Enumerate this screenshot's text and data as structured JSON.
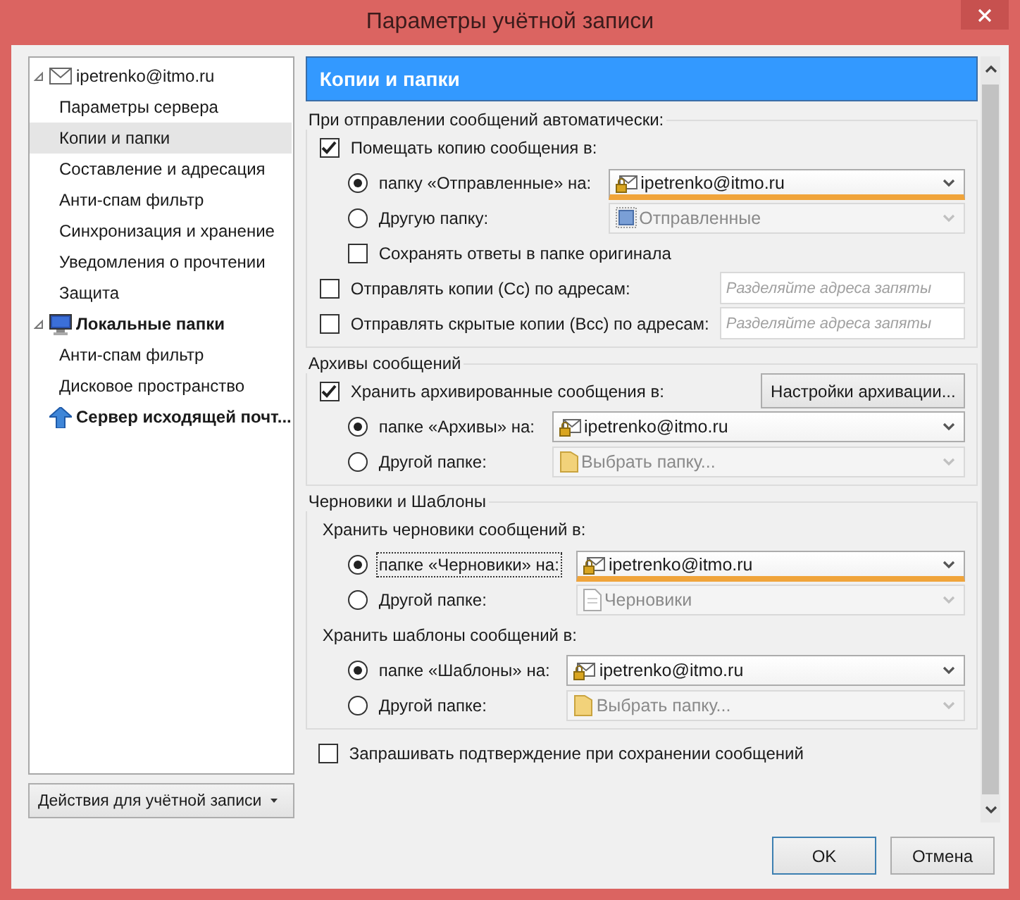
{
  "window": {
    "title": "Параметры учётной записи"
  },
  "sidebar": {
    "items": [
      {
        "label": "ipetrenko@itmo.ru",
        "kind": "mail",
        "bold": false,
        "expanded": true,
        "selected": false,
        "children": [
          {
            "label": "Параметры сервера",
            "selected": false
          },
          {
            "label": "Копии и папки",
            "selected": true
          },
          {
            "label": "Составление и адресация",
            "selected": false
          },
          {
            "label": "Анти-спам фильтр",
            "selected": false
          },
          {
            "label": "Синхронизация и хранение",
            "selected": false
          },
          {
            "label": "Уведомления о прочтении",
            "selected": false
          },
          {
            "label": "Защита",
            "selected": false
          }
        ]
      },
      {
        "label": "Локальные папки",
        "kind": "computer",
        "bold": true,
        "expanded": true,
        "selected": false,
        "children": [
          {
            "label": "Анти-спам фильтр",
            "selected": false
          },
          {
            "label": "Дисковое пространство",
            "selected": false
          }
        ]
      },
      {
        "label": "Сервер исходящей почт...",
        "kind": "upload",
        "bold": true,
        "selected": false
      }
    ]
  },
  "account_actions_button": "Действия для учётной записи",
  "panel": {
    "heading": "Копии и папки",
    "sections": [
      {
        "title": "При отправлении сообщений автоматически:",
        "rows": [
          {
            "kind": "checkbox",
            "label": "Помещать копию сообщения в:",
            "checked": true,
            "children": [
              {
                "kind": "radio",
                "label": "папку «Отправленные» на:",
                "selected": true,
                "focused": false,
                "combo": {
                  "value": "ipetrenko@itmo.ru",
                  "kind": "account",
                  "disabled": false,
                  "highlighted": true
                }
              },
              {
                "kind": "radio",
                "label": "Другую папку:",
                "selected": false,
                "focused": false,
                "combo": {
                  "value": "Отправленные",
                  "kind": "sent",
                  "disabled": true,
                  "highlighted": false
                }
              },
              {
                "kind": "checkbox",
                "label": "Сохранять ответы в папке оригинала",
                "checked": false
              }
            ]
          },
          {
            "kind": "checkbox",
            "label": "Отправлять копии (Cc) по адресам:",
            "checked": false,
            "field": {
              "placeholder": "Разделяйте адреса запяты"
            }
          },
          {
            "kind": "checkbox",
            "label": "Отправлять скрытые копии (Bcc) по адресам:",
            "checked": false,
            "field": {
              "placeholder": "Разделяйте адреса запяты"
            }
          }
        ]
      },
      {
        "title": "Архивы сообщений",
        "rows": [
          {
            "kind": "checkbox",
            "label": "Хранить архивированные сообщения в:",
            "checked": true,
            "button": "Настройки архивации...",
            "children": [
              {
                "kind": "radio",
                "label": "папке «Архивы» на:",
                "selected": true,
                "focused": false,
                "combo": {
                  "value": "ipetrenko@itmo.ru",
                  "kind": "account",
                  "disabled": false,
                  "highlighted": false
                }
              },
              {
                "kind": "radio",
                "label": "Другой папке:",
                "selected": false,
                "focused": false,
                "combo": {
                  "value": "Выбрать папку...",
                  "kind": "folder",
                  "disabled": true,
                  "highlighted": false
                }
              }
            ]
          }
        ]
      },
      {
        "title": "Черновики и Шаблоны",
        "rows": [
          {
            "kind": "label",
            "label": "Хранить черновики сообщений в:",
            "children": [
              {
                "kind": "radio",
                "label": "папке «Черновики» на:",
                "selected": true,
                "focused": true,
                "combo": {
                  "value": "ipetrenko@itmo.ru",
                  "kind": "account",
                  "disabled": false,
                  "highlighted": true
                }
              },
              {
                "kind": "radio",
                "label": "Другой папке:",
                "selected": false,
                "focused": false,
                "combo": {
                  "value": "Черновики",
                  "kind": "draft",
                  "disabled": true,
                  "highlighted": false
                }
              }
            ]
          },
          {
            "kind": "label",
            "label": "Хранить шаблоны сообщений в:",
            "children": [
              {
                "kind": "radio",
                "label": "папке «Шаблоны» на:",
                "selected": true,
                "focused": false,
                "combo": {
                  "value": "ipetrenko@itmo.ru",
                  "kind": "account",
                  "disabled": false,
                  "highlighted": false
                }
              },
              {
                "kind": "radio",
                "label": "Другой папке:",
                "selected": false,
                "focused": false,
                "combo": {
                  "value": "Выбрать папку...",
                  "kind": "folder",
                  "disabled": true,
                  "highlighted": false
                }
              }
            ]
          }
        ]
      }
    ],
    "confirm_checkbox": {
      "label": "Запрашивать подтверждение при сохранении сообщений",
      "checked": false
    }
  },
  "buttons": [
    {
      "label": "OK",
      "default": true
    },
    {
      "label": "Отмена",
      "default": false
    }
  ]
}
